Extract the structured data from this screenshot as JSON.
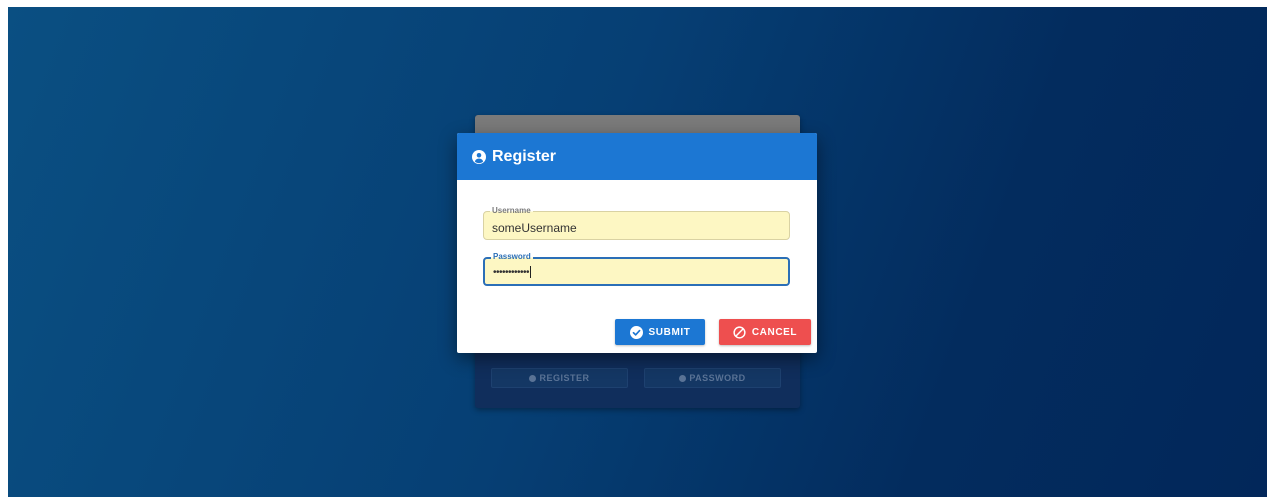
{
  "background_card": {
    "buttons": [
      {
        "label": "REGISTER",
        "icon": "user-icon"
      },
      {
        "label": "PASSWORD",
        "icon": "key-icon"
      }
    ]
  },
  "dialog": {
    "title": "Register",
    "title_icon": "user-circle-icon",
    "fields": {
      "username": {
        "label": "Username",
        "value": "someUsername"
      },
      "password": {
        "label": "Password",
        "value": "••••••••••••"
      }
    },
    "buttons": {
      "submit": {
        "label": "SUBMIT",
        "icon": "check-circle-icon"
      },
      "cancel": {
        "label": "CANCEL",
        "icon": "ban-icon"
      }
    }
  },
  "colors": {
    "primary": "#1c77d3",
    "danger": "#ee4f4f",
    "field_bg": "#fdf7c3"
  }
}
